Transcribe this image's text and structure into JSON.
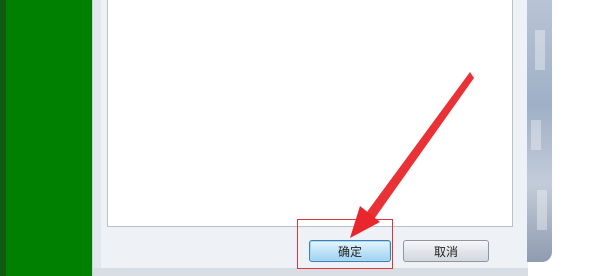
{
  "dialog": {
    "ok_label": "确定",
    "cancel_label": "取消"
  },
  "colors": {
    "left_panel": "#008000",
    "highlight": "#e0353a",
    "arrow": "#e8262b"
  },
  "icons": {
    "arrow": "red-pointer-arrow"
  }
}
